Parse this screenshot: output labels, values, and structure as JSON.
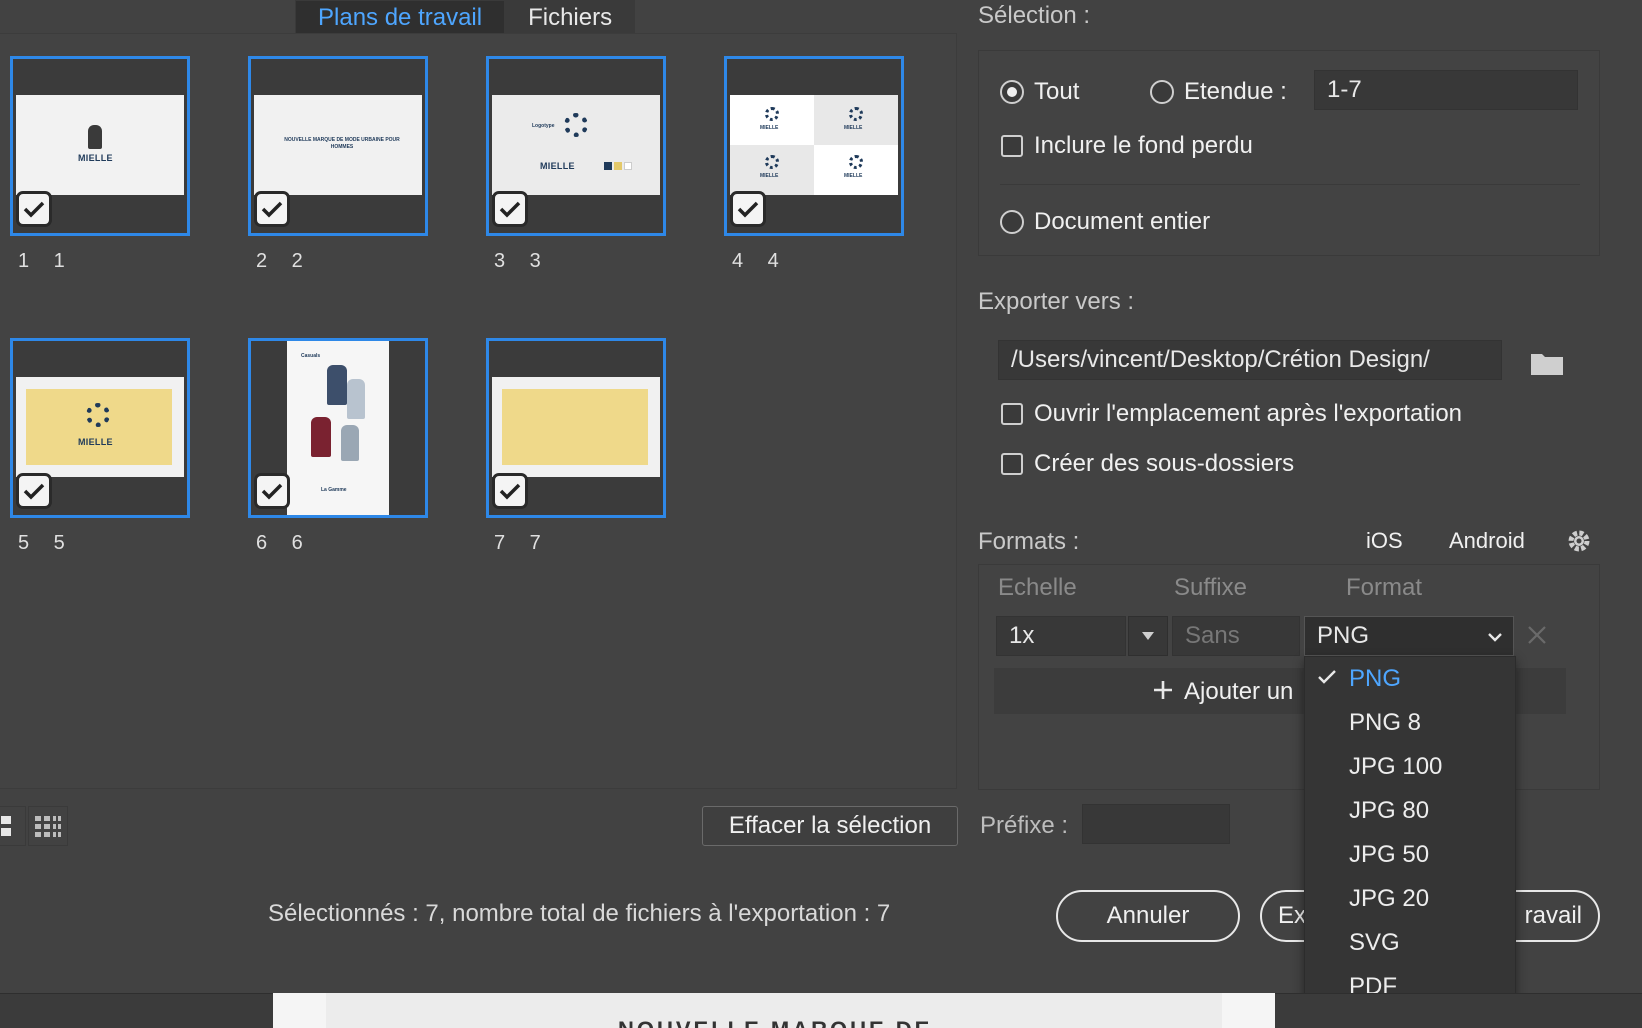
{
  "tabs": [
    {
      "label": "Plans de travail",
      "active": true
    },
    {
      "label": "Fichiers",
      "active": false
    }
  ],
  "artboards": [
    {
      "label": "1 1",
      "checked": true,
      "thumb_text": "MIELLE"
    },
    {
      "label": "2 2",
      "checked": true,
      "thumb_text": "NOUVELLE MARQUE DE MODE URBAINE POUR HOMMES"
    },
    {
      "label": "3 3",
      "checked": true,
      "thumb_text": "MIELLE",
      "thumb_caption": "Logotype"
    },
    {
      "label": "4 4",
      "checked": true,
      "thumb_text": "MIELLE"
    },
    {
      "label": "5 5",
      "checked": true,
      "thumb_text": "MIELLE"
    },
    {
      "label": "6 6",
      "checked": true,
      "thumb_text": "La Gamme",
      "thumb_caption": "Casuals"
    },
    {
      "label": "7 7",
      "checked": true
    }
  ],
  "clear_selection_label": "Effacer la sélection",
  "status_text": "Sélectionnés : 7, nombre total de fichiers à l'exportation : 7",
  "cancel_label": "Annuler",
  "export_label_visible_left": "Ex",
  "export_label_visible_right": "ravail",
  "selection": {
    "title": "Sélection :",
    "all_label": "Tout",
    "range_label": "Etendue :",
    "range_value": "1-7",
    "bleed_label": "Inclure le fond perdu",
    "whole_doc_label": "Document entier",
    "selected_option": "Tout"
  },
  "export_to": {
    "title": "Exporter vers :",
    "path": "/Users/vincent/Desktop/Crétion Design/",
    "open_location_label": "Ouvrir l'emplacement après l'exportation",
    "subfolders_label": "Créer des sous-dossiers"
  },
  "formats": {
    "title": "Formats :",
    "ios_label": "iOS",
    "android_label": "Android",
    "col_scale": "Echelle",
    "col_suffix": "Suffixe",
    "col_format": "Format",
    "scale_value": "1x",
    "suffix_placeholder": "Sans",
    "format_value": "PNG",
    "add_label": "Ajouter un",
    "prefix_label": "Préfixe :",
    "prefix_value": ""
  },
  "format_menu": {
    "options": [
      "PNG",
      "PNG 8",
      "JPG 100",
      "JPG 80",
      "JPG 50",
      "JPG 20",
      "SVG",
      "PDF"
    ],
    "selected": "PNG"
  },
  "document_preview_text": "NOUVELLE MARQUE DE",
  "colors": {
    "accent": "#4ea6ff",
    "artboard_border": "#2e88e8",
    "panel_bg": "#424242",
    "thumb_yellow": "#efd98a",
    "brand_navy": "#1f3a5a"
  }
}
